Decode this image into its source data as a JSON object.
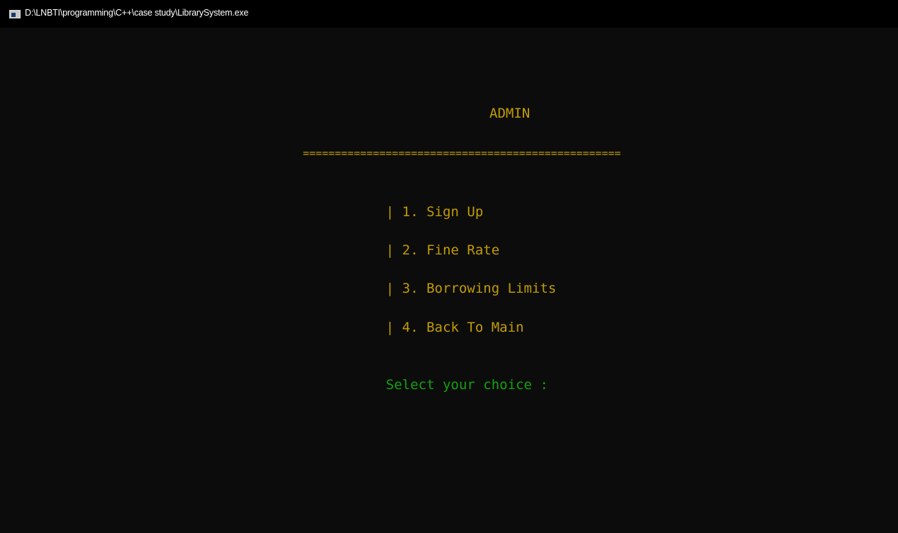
{
  "window": {
    "title": "D:\\LNBTI\\programming\\C++\\case study\\LibrarySystem.exe",
    "icon": "console-app-icon"
  },
  "console": {
    "heading": "ADMIN",
    "separator": "==================================================",
    "menu": [
      {
        "label": "| 1. Sign Up"
      },
      {
        "label": "| 2. Fine Rate"
      },
      {
        "label": "| 3. Borrowing Limits"
      },
      {
        "label": "| 4. Back To Main"
      }
    ],
    "prompt": "Select your choice : "
  },
  "colors": {
    "background": "#0c0c0c",
    "titlebar": "#000000",
    "menu_text": "#c19c00",
    "prompt_text": "#13a10e"
  }
}
